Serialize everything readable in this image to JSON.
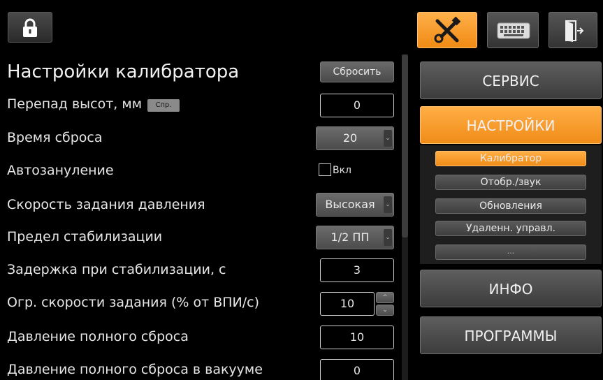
{
  "topbar": {
    "icons": [
      "lock-icon",
      "tools-icon",
      "keyboard-icon",
      "exit-icon"
    ],
    "accent": "#f59a22"
  },
  "settings": {
    "title": "Настройки калибратора",
    "reset_label": "Сбросить",
    "rows": [
      {
        "label": "Перепад высот, мм",
        "badge": "Спр.",
        "value": "0"
      },
      {
        "label": "Время сброса",
        "value": "20"
      },
      {
        "label": "Автозануление",
        "checkbox_label": "Вкл",
        "checked": false
      },
      {
        "label": "Скорость задания давления",
        "value": "Высокая"
      },
      {
        "label": "Предел стабилизации",
        "value": "1/2 ПП"
      },
      {
        "label": "Задержка при стабилизации, с",
        "value": "3"
      },
      {
        "label": "Огр. скорости задания (% от ВПИ/с)",
        "value": "10"
      },
      {
        "label": "Давление полного сброса",
        "value": "10"
      },
      {
        "label": "Давление полного сброса в вакууме",
        "value": "0"
      }
    ]
  },
  "nav": {
    "service": "СЕРВИС",
    "settings": "НАСТРОЙКИ",
    "info": "ИНФО",
    "programs": "ПРОГРАММЫ",
    "sub_items": [
      "Калибратор",
      "Отобр./звук",
      "Обновления",
      "Удаленн. управл.",
      "..."
    ]
  }
}
